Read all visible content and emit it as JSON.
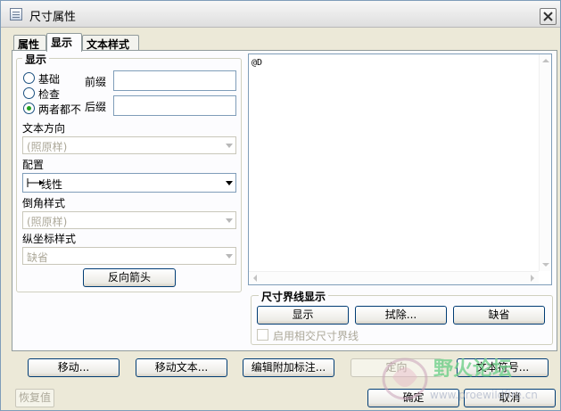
{
  "window": {
    "title": "尺寸属性"
  },
  "tabs": [
    {
      "label": "属性"
    },
    {
      "label": "显示"
    },
    {
      "label": "文本样式"
    }
  ],
  "display_group": {
    "legend": "显示",
    "radios": [
      {
        "label": "基础",
        "checked": false
      },
      {
        "label": "检查",
        "checked": false
      },
      {
        "label": "两者都不",
        "checked": true
      }
    ],
    "prefix_label": "前缀",
    "prefix_value": "",
    "suffix_label": "后缀",
    "suffix_value": ""
  },
  "text_direction": {
    "label": "文本方向",
    "value": "(照原样)"
  },
  "config": {
    "label": "配置",
    "value": "线性",
    "icon": "linear-dimension-icon"
  },
  "chamfer_style": {
    "label": "倒角样式",
    "value": "(照原样)"
  },
  "ordinate_style": {
    "label": "纵坐标样式",
    "value": "缺省"
  },
  "flip_arrow_button": "反向箭头",
  "text_area": {
    "value": "@D"
  },
  "witness_group": {
    "legend": "尺寸界线显示",
    "show_button": "显示",
    "erase_button": "拭除...",
    "default_button": "缺省",
    "checkbox_label": "启用相交尺寸界线"
  },
  "bottom_buttons": {
    "move": "移动...",
    "move_text": "移动文本...",
    "edit_attachment": "编辑附加标注...",
    "orient": "定向",
    "text_symbol": "文本符号..."
  },
  "footer": {
    "restore": "恢复值",
    "ok": "确定",
    "cancel": "取消"
  },
  "watermark": {
    "text": "野火论坛",
    "url": "www.proewildfire.cn"
  }
}
